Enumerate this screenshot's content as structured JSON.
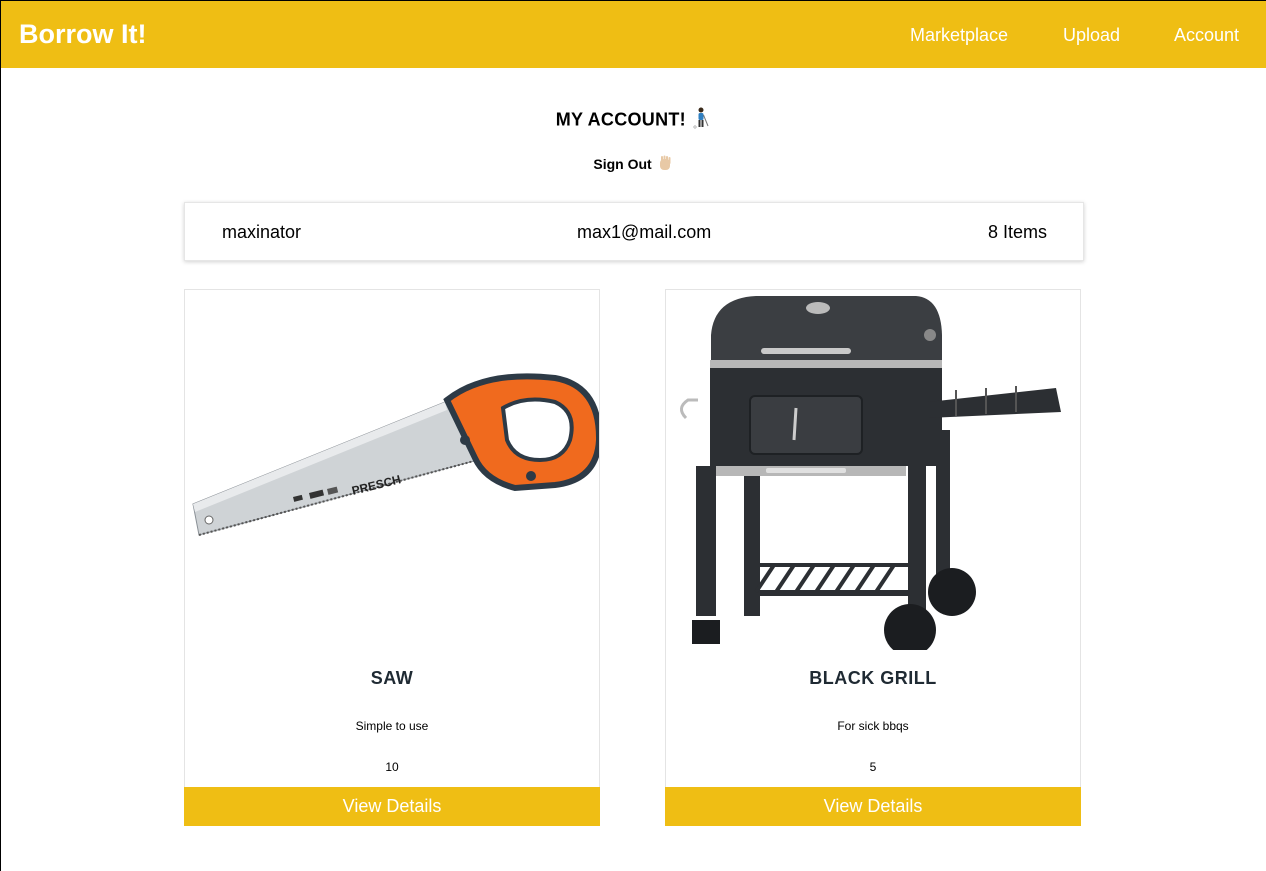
{
  "navbar": {
    "brand": "Borrow It!",
    "links": [
      "Marketplace",
      "Upload",
      "Account"
    ],
    "color": "#EFBE14"
  },
  "page": {
    "title": "MY ACCOUNT!",
    "title_emoji": "golfer-icon",
    "signout": "Sign Out",
    "signout_emoji": "waving-hand-icon"
  },
  "user": {
    "username": "maxinator",
    "email": "max1@mail.com",
    "item_count": "8",
    "items_label": "Items"
  },
  "items": [
    {
      "name": "SAW",
      "description": "Simple to use",
      "quantity": "10",
      "button": "View Details",
      "image": "hand-saw-image"
    },
    {
      "name": "BLACK GRILL",
      "description": "For sick bbqs",
      "quantity": "5",
      "button": "View Details",
      "image": "charcoal-grill-image"
    }
  ]
}
